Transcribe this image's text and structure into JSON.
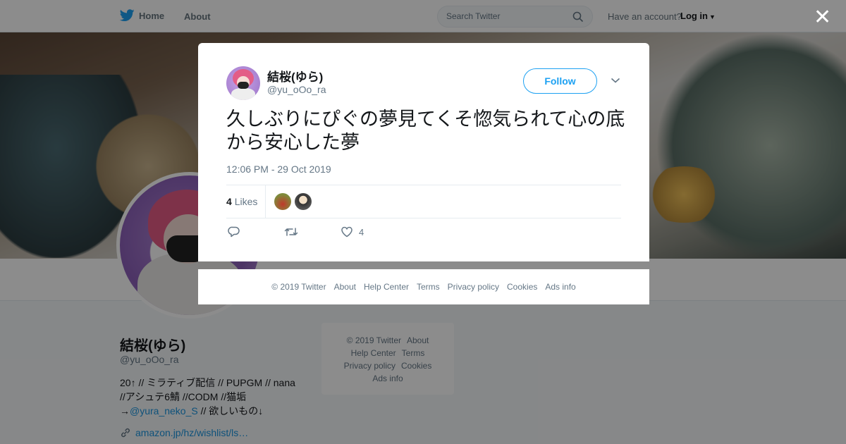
{
  "nav": {
    "home_label": "Home",
    "about_label": "About",
    "search_placeholder": "Search Twitter",
    "have_account": "Have an account?",
    "login_label": "Log in"
  },
  "profile": {
    "name": "結桜(ゆら)",
    "handle": "@yu_oOo_ra",
    "bio_line1": "20↑ // ミラティブ配信 // PUPGM // nana",
    "bio_line2": "//アシュテ6鯖 //CODM //猫垢",
    "bio_line3_prefix": "→",
    "bio_mention": "@yura_neko_S",
    "bio_line3_suffix": " // 欲しいもの↓",
    "link": "amazon.jp/hz/wishlist/ls…"
  },
  "side_footer": {
    "copyright": "© 2019 Twitter",
    "about": "About",
    "help": "Help Center",
    "terms": "Terms",
    "privacy": "Privacy policy",
    "cookies": "Cookies",
    "ads": "Ads info"
  },
  "tweet": {
    "author_name": "結桜(ゆら)",
    "author_handle": "@yu_oOo_ra",
    "follow_label": "Follow",
    "text": "久しぶりにぴぐの夢見てくそ惚気られて心の底から安心した夢",
    "timestamp": "12:06 PM - 29 Oct 2019",
    "likes_count": "4",
    "likes_label": "Likes",
    "like_action_count": "4"
  },
  "modal_footer": {
    "copyright": "© 2019 Twitter",
    "about": "About",
    "help": "Help Center",
    "terms": "Terms",
    "privacy": "Privacy policy",
    "cookies": "Cookies",
    "ads": "Ads info"
  },
  "icons": {
    "bird": "twitter-bird-icon",
    "search": "search-icon",
    "close": "close-icon",
    "reply": "reply-icon",
    "retweet": "retweet-icon",
    "like": "heart-icon",
    "link": "link-icon"
  },
  "colors": {
    "brand": "#1da1f2",
    "link": "#1b95e0",
    "muted": "#657786"
  }
}
